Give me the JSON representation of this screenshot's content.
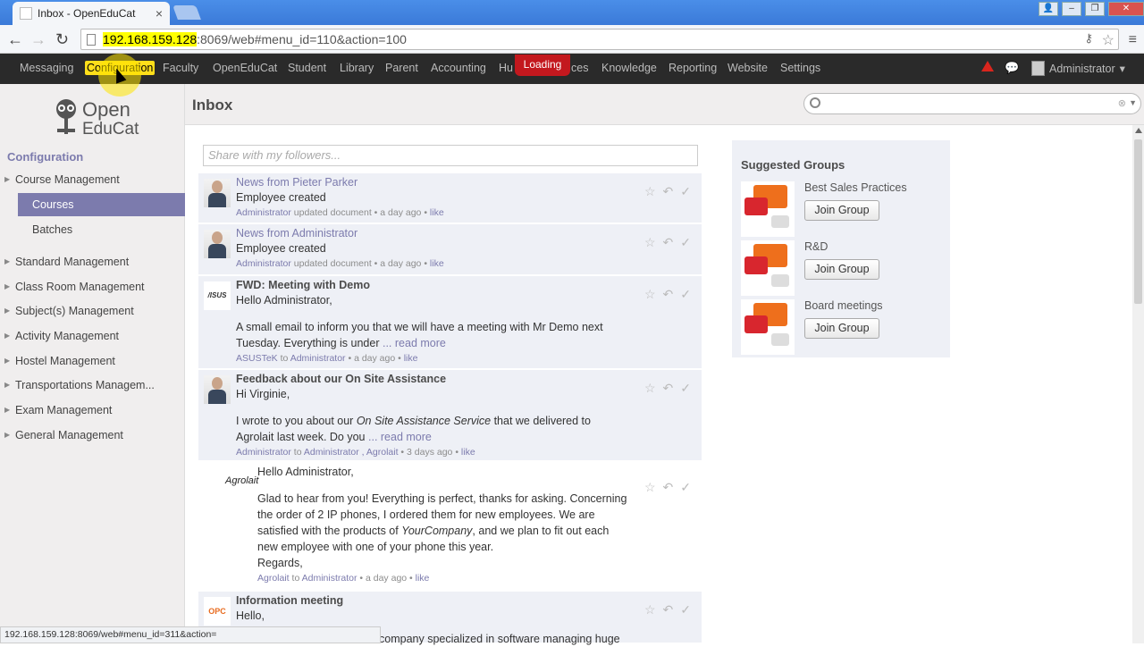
{
  "browser": {
    "tab_title": "Inbox - OpenEduCat",
    "url_host": "192.168.159.128",
    "url_rest": ":8069/web#menu_id=110&action=100",
    "status_url": "192.168.159.128:8069/web#menu_id=311&action="
  },
  "topnav": {
    "items": [
      "Messaging",
      "Configuration",
      "Faculty",
      "OpenEduCat",
      "Student",
      "Library",
      "Parent",
      "Accounting",
      "Hu",
      "ces",
      "Knowledge",
      "Reporting",
      "Website",
      "Settings"
    ],
    "active": "Configuration",
    "loading": "Loading",
    "user": "Administrator"
  },
  "sidebar": {
    "logo_line1": "Open",
    "logo_line2": "EduCat",
    "heading": "Configuration",
    "items": [
      "Course Management",
      "Standard Management",
      "Class Room Management",
      "Subject(s) Management",
      "Activity Management",
      "Hostel Management",
      "Transportations Managem...",
      "Exam Management",
      "General Management"
    ],
    "sub_items": [
      "Courses",
      "Batches"
    ]
  },
  "main": {
    "title": "Inbox",
    "share_placeholder": "Share with my followers..."
  },
  "messages": [
    {
      "subject": "News from Pieter Parker",
      "line": "Employee created",
      "meta_author": "Administrator",
      "meta_rest": "updated document • a day ago • ",
      "like": "like"
    },
    {
      "subject": "News from Administrator",
      "line": "Employee created",
      "meta_author": "Administrator",
      "meta_rest": "updated document • a day ago • ",
      "like": "like"
    },
    {
      "subject": "FWD: Meeting with Demo",
      "greet": "Hello Administrator,",
      "body1": "A small email to inform you that we will have a meeting with Mr Demo next",
      "body2": "Tuesday. Everything is under ",
      "more": "... read more",
      "meta_author": "ASUSTeK",
      "meta_mid": " to ",
      "meta_to": "Administrator",
      "meta_rest": " • a day ago • ",
      "like": "like",
      "pic_text": "/ISUS"
    },
    {
      "subject": "Feedback about our On Site Assistance",
      "greet": "Hi Virginie,",
      "body1a": "I wrote to you about our ",
      "body1i": "On Site Assistance Service",
      "body1b": " that we delivered to",
      "body2": "Agrolait last week. Do you ",
      "more": "... read more",
      "meta_author": "Administrator",
      "meta_mid": " to ",
      "meta_to": "Administrator , Agrolait",
      "meta_rest": " • 3 days ago • ",
      "like": "like"
    },
    {
      "greet": "Hello Administrator,",
      "body1": "Glad to hear from you! Everything is perfect, thanks for asking. Concerning",
      "body2": "the order of 2 IP phones, I ordered them for new employees. We are",
      "body3a": "satisfied with the products of ",
      "body3i": "YourCompany",
      "body3b": ", and we plan to fit out each",
      "body4": "new employee with one of your phone this year.",
      "body5": "Regards,",
      "meta_author": "Agrolait",
      "meta_mid": " to ",
      "meta_to": "Administrator",
      "meta_rest": " • a day ago • ",
      "like": "like",
      "pic_text": "Agrolait"
    },
    {
      "subject": "Information meeting",
      "greet": "Hello,",
      "body1": "company specialized in software managing huge",
      "pic_text": "OPC"
    }
  ],
  "groups": {
    "heading": "Suggested Groups",
    "items": [
      {
        "name": "Best Sales Practices",
        "button": "Join Group"
      },
      {
        "name": "R&D",
        "button": "Join Group"
      },
      {
        "name": "Board meetings",
        "button": "Join Group"
      }
    ]
  }
}
